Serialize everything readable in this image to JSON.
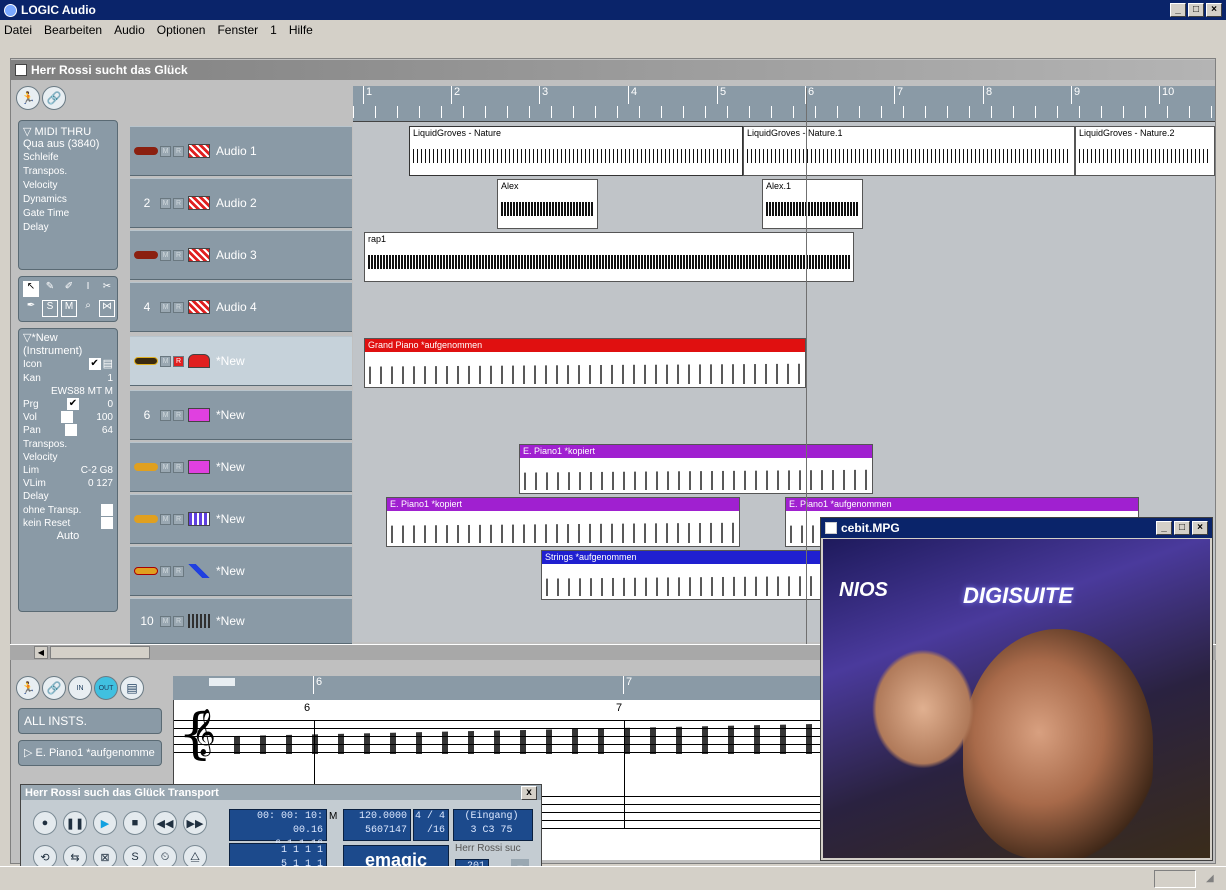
{
  "app": {
    "title": "LOGIC Audio"
  },
  "menu": [
    "Datei",
    "Bearbeiten",
    "Audio",
    "Optionen",
    "Fenster",
    "1",
    "Hilfe"
  ],
  "arrange": {
    "title": "Herr Rossi sucht das Glück",
    "ruler": [
      "1",
      "2",
      "3",
      "4",
      "5",
      "6",
      "7",
      "8",
      "9",
      "10"
    ]
  },
  "inspector": {
    "midi": [
      "▽ MIDI THRU",
      "Qua  aus (3840)",
      "Schleife",
      "Transpos.",
      "Velocity",
      "Dynamics",
      "Gate Time",
      "Delay"
    ],
    "inst": {
      "header": "▽*New",
      "type": "(Instrument)",
      "icon_label": "Icon",
      "kan_label": "Kan",
      "kan_value": "1",
      "device": "EWS88 MT M",
      "prg_label": "Prg",
      "prg_value": "0",
      "vol_label": "Vol",
      "vol_value": "100",
      "pan_label": "Pan",
      "pan_value": "64",
      "transpos": "Transpos.",
      "velocity": "Velocity",
      "lim_label": "Lim",
      "lim_value": "C-2  G8",
      "vlim_label": "VLim",
      "vlim_value": "0  127",
      "delay": "Delay",
      "ohne": "ohne Transp.",
      "kein": "kein Reset",
      "auto": "Auto"
    }
  },
  "tracks": [
    {
      "num": "",
      "name": "Audio 1"
    },
    {
      "num": "2",
      "name": "Audio 2"
    },
    {
      "num": "",
      "name": "Audio 3"
    },
    {
      "num": "4",
      "name": "Audio 4"
    },
    {
      "num": "",
      "name": "*New"
    },
    {
      "num": "6",
      "name": "*New"
    },
    {
      "num": "",
      "name": "*New"
    },
    {
      "num": "",
      "name": "*New"
    },
    {
      "num": "",
      "name": "*New"
    },
    {
      "num": "10",
      "name": "*New"
    }
  ],
  "regions": {
    "r1": "LiquidGroves - Nature",
    "r2": "LiquidGroves - Nature.1",
    "r3": "LiquidGroves - Nature.2",
    "r4": "Alex",
    "r5": "Alex.1",
    "r6": "rap1",
    "r7": "Grand Piano *aufgenommen",
    "r8": "E. Piano1 *kopiert",
    "r9": "E. Piano1 *kopiert",
    "r10": "E. Piano1 *aufgenommen",
    "r11": "Strings *aufgenommen"
  },
  "score": {
    "all_insts": "ALL INSTS.",
    "region": "▷ E. Piano1 *aufgenomme",
    "ruler": [
      "6",
      "7"
    ],
    "bar_numbers": [
      "6",
      "7"
    ]
  },
  "transport": {
    "title": "Herr Rossi such das Glück Transport",
    "close": "x",
    "smpte": "00: 00: 10: 00.16",
    "pos": "6   1   1   16",
    "loc1": "1   1   1   1",
    "loc2": "5   1   1   1",
    "tempo": "120.0000",
    "ticks": "5607147",
    "sig": "4 / 4",
    "div": "/16",
    "eingang": "(Eingang)",
    "midi_in": "3  C3   75",
    "song": "Herr Rossi suc",
    "song_num": "201",
    "brand": "emagic",
    "m_label": "M"
  },
  "video": {
    "title": "cebit.MPG",
    "sign": "DIGISUITE",
    "sign2": "NIOS"
  },
  "colors": {
    "title_bar": "#0a246a",
    "grand_piano": "#e01010",
    "e_piano": "#a020d0",
    "strings": "#2020d0",
    "panel": "#8a9aa6"
  }
}
